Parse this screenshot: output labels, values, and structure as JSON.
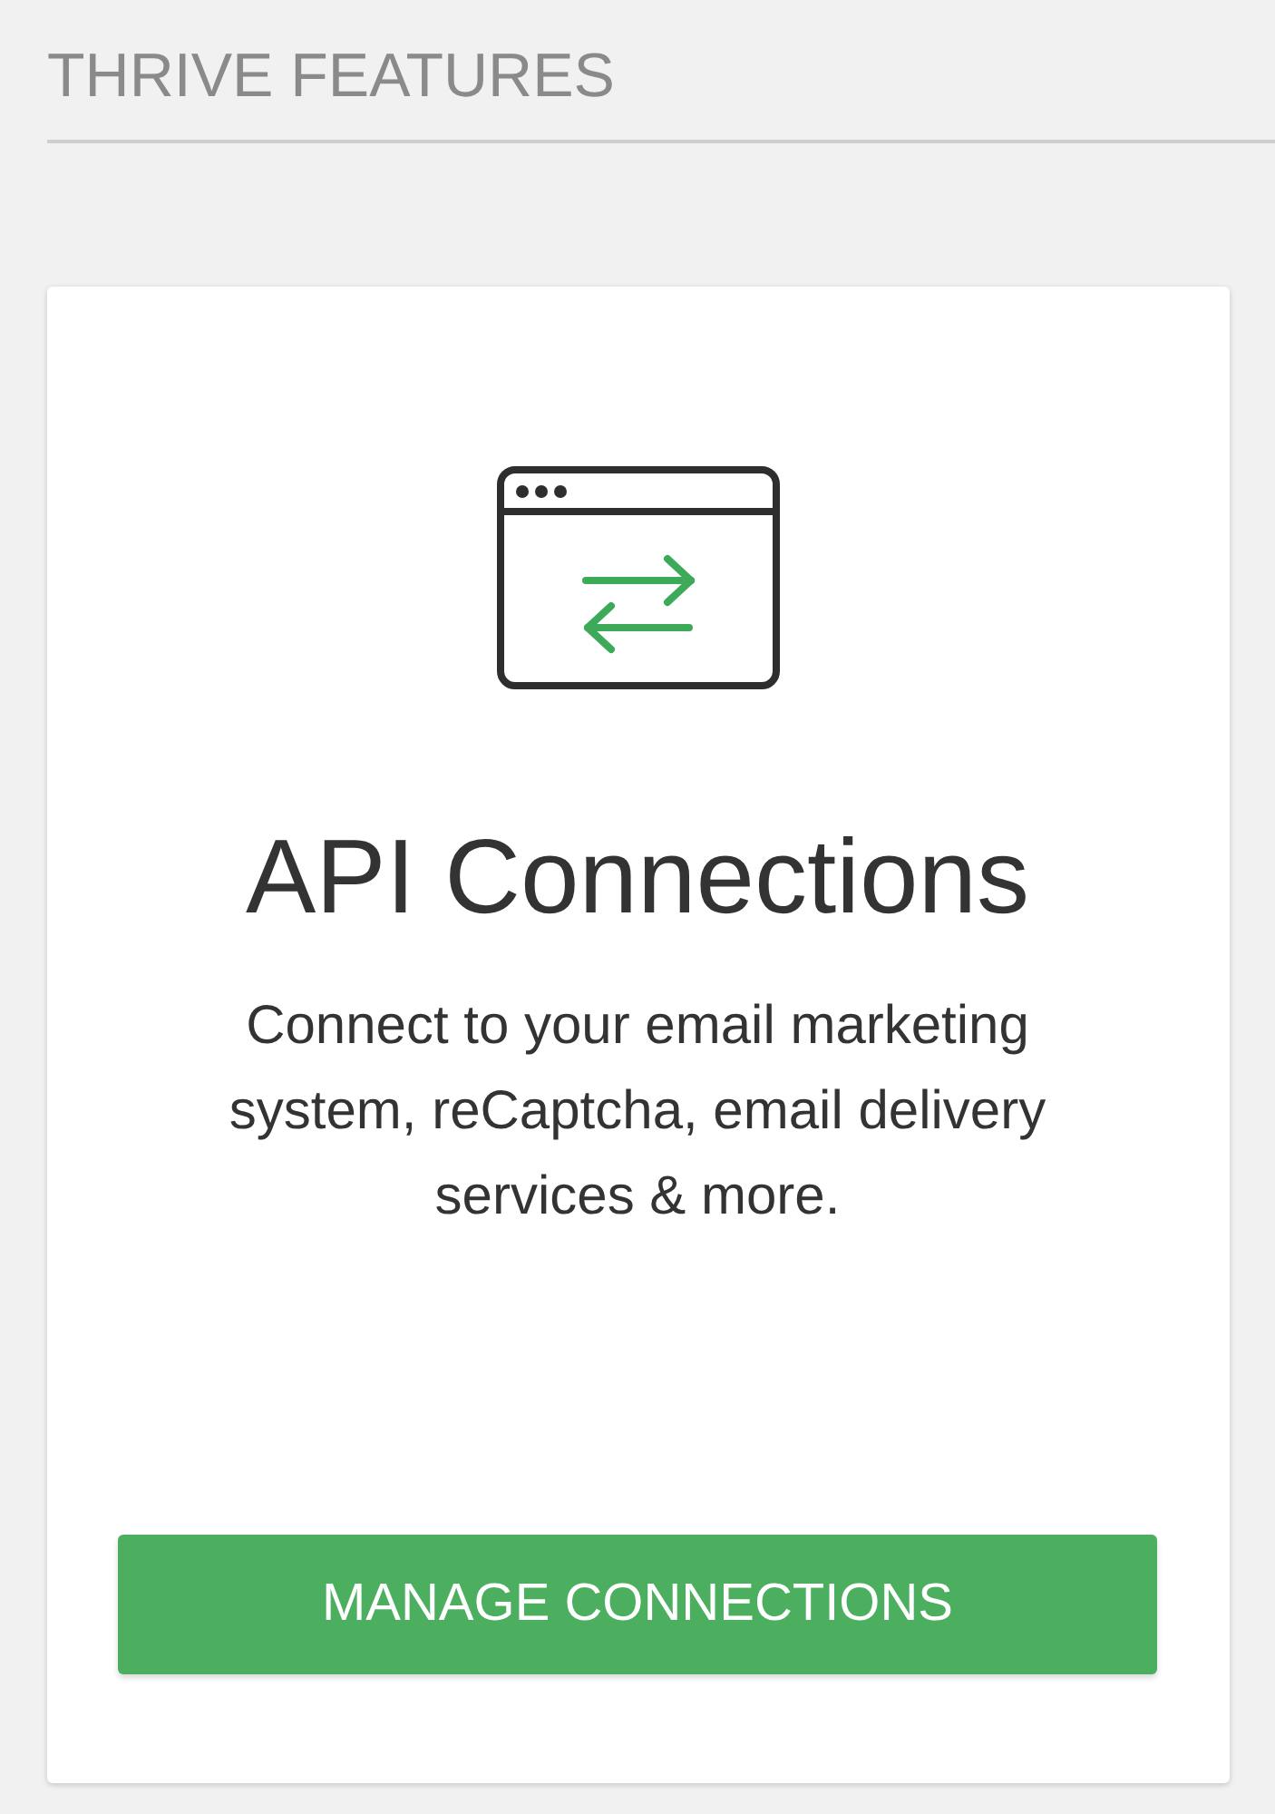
{
  "section_title": "THRIVE FEATURES",
  "card": {
    "title": "API Connections",
    "description": "Connect to your email marketing system, reCaptcha, email delivery services & more.",
    "button": "MANAGE CONNECTIONS"
  }
}
